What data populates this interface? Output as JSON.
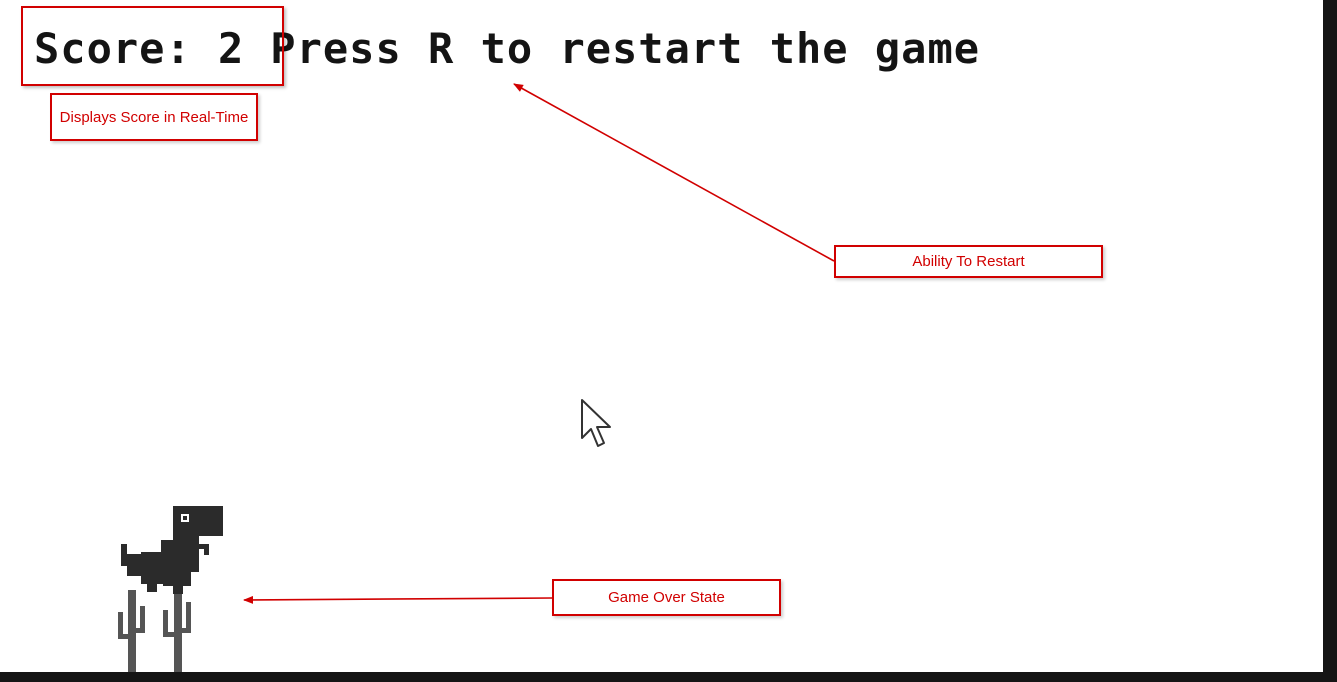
{
  "hud": {
    "score_text": "Score: 2",
    "score_value": 2,
    "restart_prompt": "Press R to restart the game"
  },
  "annotations": {
    "score": "Displays Score in Real-Time",
    "restart": "Ability To Restart",
    "game_over": "Game Over State"
  },
  "sprites": {
    "player": "t-rex-dinosaur",
    "obstacle": "cactus-cluster"
  },
  "game_state": "game-over",
  "colors": {
    "annotation": "#d10000",
    "sprite": "#2b2b2b",
    "cactus": "#555555",
    "hud_text": "#141414",
    "background": "#ffffff",
    "frame": "#151515"
  }
}
